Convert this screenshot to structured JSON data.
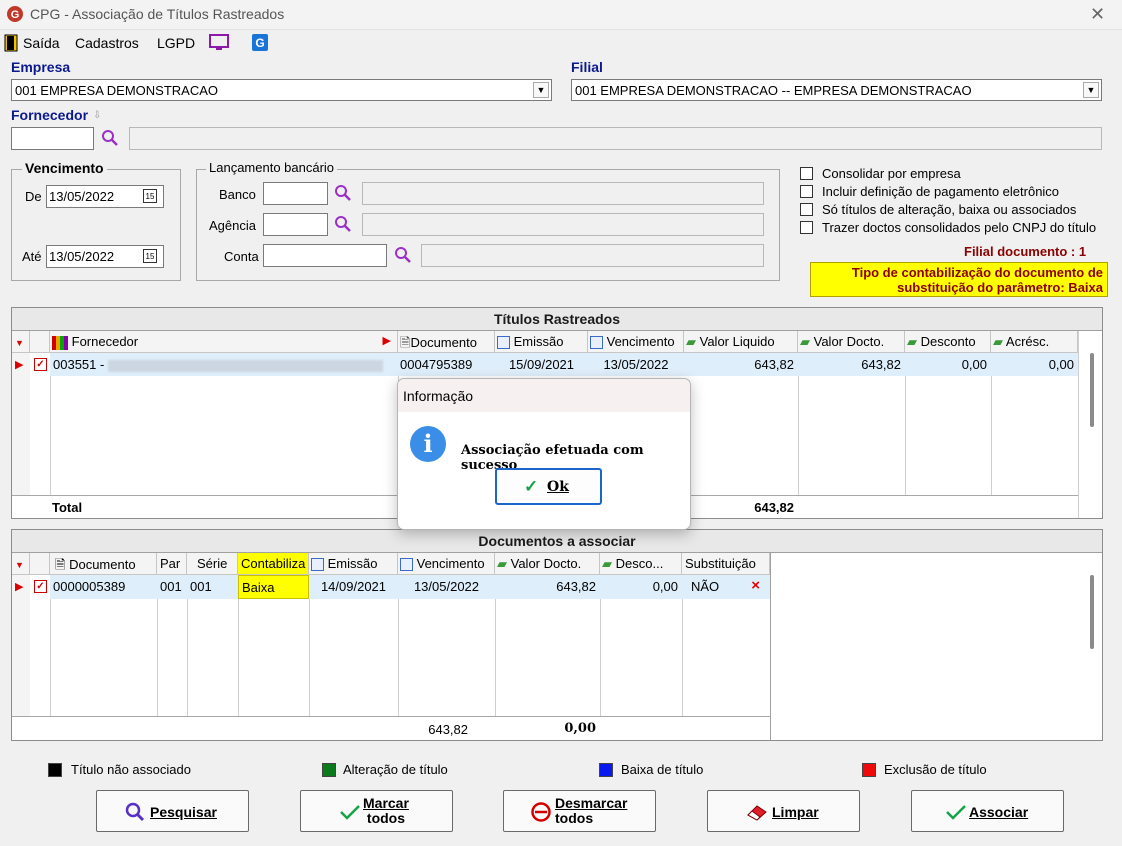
{
  "window": {
    "title": "CPG - Associação de Títulos Rastreados",
    "close_glyph": "✕"
  },
  "menu": {
    "saida": "Saída",
    "cadastros": "Cadastros",
    "lgpd": "LGPD"
  },
  "empresa": {
    "label": "Empresa",
    "value": "001 EMPRESA DEMONSTRACAO"
  },
  "filial": {
    "label": "Filial",
    "value": "001 EMPRESA DEMONSTRACAO -- EMPRESA DEMONSTRACAO"
  },
  "fornecedor": {
    "label": "Fornecedor",
    "code": "",
    "name": ""
  },
  "vencimento": {
    "title": "Vencimento",
    "de_label": "De",
    "de_value": "13/05/2022",
    "ate_label": "Até",
    "ate_value": "13/05/2022",
    "cal_glyph": "15"
  },
  "lancamento": {
    "title": "Lançamento bancário",
    "banco": "Banco",
    "agencia": "Agência",
    "conta": "Conta"
  },
  "options": [
    {
      "label": "Consolidar por empresa",
      "checked": false
    },
    {
      "label": "Incluir definição de pagamento eletrônico",
      "checked": false
    },
    {
      "label": "Só títulos de alteração, baixa ou associados",
      "checked": false
    },
    {
      "label": "Trazer doctos consolidados pelo CNPJ do título",
      "checked": false
    }
  ],
  "filial_documento": "Filial documento : 1",
  "tipo_contabilizacao": {
    "line1": "Tipo de contabilização do documento de",
    "line2": "substituição do parâmetro: Baixa"
  },
  "titulos": {
    "title": "Títulos Rastreados",
    "headers": [
      "Fornecedor",
      "Documento",
      "Emissão",
      "Vencimento",
      "Valor Liquido",
      "Valor Docto.",
      "Desconto",
      "Acrésc."
    ],
    "row": {
      "fornecedor": "003551 -",
      "documento": "0004795389",
      "emissao": "15/09/2021",
      "vencimento": "13/05/2022",
      "valor_liquido": "643,82",
      "valor_docto": "643,82",
      "desconto": "0,00",
      "acresc": "0,00"
    },
    "total_label": "Total",
    "total_value": "643,82"
  },
  "documentos": {
    "title": "Documentos a associar",
    "headers": [
      "Documento",
      "Par",
      "Série",
      "Contabiliza",
      "Emissão",
      "Vencimento",
      "Valor Docto.",
      "Desco...",
      "Substituição"
    ],
    "row": {
      "documento": "0000005389",
      "par": "001",
      "serie": "001",
      "contabiliza": "Baixa",
      "emissao": "14/09/2021",
      "vencimento": "13/05/2022",
      "valor_docto": "643,82",
      "desconto": "0,00",
      "substituicao": "NÃO",
      "remove_glyph": "×"
    },
    "total_valor": "643,82",
    "total_desconto": "0,00"
  },
  "legend": [
    {
      "label": "Título não associado",
      "color": "#000000"
    },
    {
      "label": "Alteração de título",
      "color": "#0a7a1a"
    },
    {
      "label": "Baixa de título",
      "color": "#0a1aee"
    },
    {
      "label": "Exclusão de título",
      "color": "#ee0a0a"
    }
  ],
  "buttons": {
    "pesquisar": "Pesquisar",
    "marcar_1": "Marcar",
    "marcar_2": "todos",
    "desmarcar_1": "Desmarcar",
    "desmarcar_2": "todos",
    "limpar": "Limpar",
    "associar": "Associar"
  },
  "dialog": {
    "title": "Informação",
    "message": "Associação efetuada com sucesso",
    "ok": "Ok",
    "icon_glyph": "i",
    "ok_glyph": "✓"
  },
  "colors": {
    "accent_blue": "#0a1a8c",
    "highlight_yellow": "#ffff00",
    "selected_row": "#dfeefb",
    "dark_red": "#8b0000"
  }
}
